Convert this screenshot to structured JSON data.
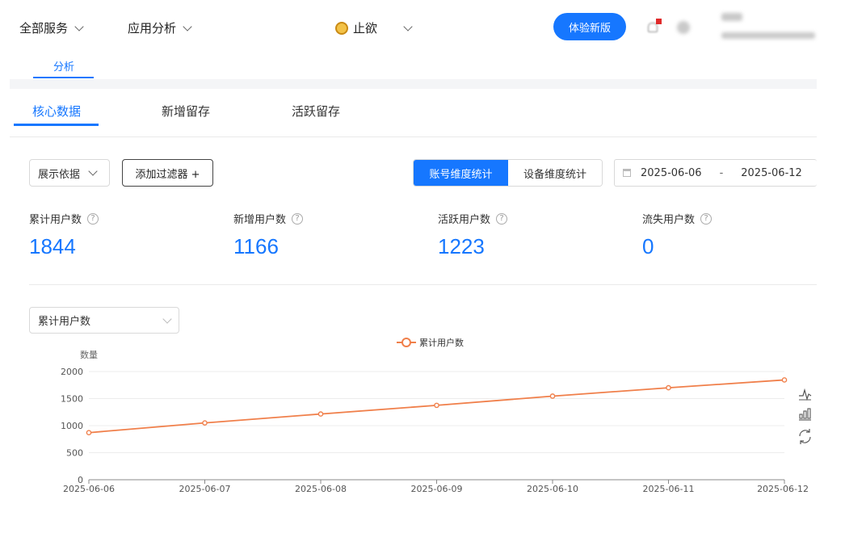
{
  "topnav": {
    "all_services": "全部服务",
    "app_analysis": "应用分析",
    "app_name": "止欲",
    "try_new": "体验新版"
  },
  "subtab": {
    "label": "分析"
  },
  "tabs": [
    {
      "label": "核心数据",
      "active": true
    },
    {
      "label": "新增留存",
      "active": false
    },
    {
      "label": "活跃留存",
      "active": false
    }
  ],
  "filters": {
    "display_basis": "展示依据",
    "add_filter": "添加过滤器 +",
    "account_stats": "账号维度统计",
    "device_stats": "设备维度统计",
    "date_start": "2025-06-06",
    "date_sep": "-",
    "date_end": "2025-06-12"
  },
  "stats": [
    {
      "label": "累计用户数",
      "value": "1844"
    },
    {
      "label": "新增用户数",
      "value": "1166"
    },
    {
      "label": "活跃用户数",
      "value": "1223"
    },
    {
      "label": "流失用户数",
      "value": "0"
    }
  ],
  "metric_select": {
    "value": "累计用户数"
  },
  "colors": {
    "accent": "#1677ff",
    "series": "#f07f4a"
  },
  "chart_data": {
    "type": "line",
    "ylabel": "数量",
    "ylim": [
      0,
      2000
    ],
    "yticks": [
      "0",
      "500",
      "1000",
      "1500",
      "2000"
    ],
    "categories": [
      "2025-06-06",
      "2025-06-07",
      "2025-06-08",
      "2025-06-09",
      "2025-06-10",
      "2025-06-11",
      "2025-06-12"
    ],
    "series": [
      {
        "name": "累计用户数",
        "values": [
          870,
          1050,
          1215,
          1375,
          1545,
          1700,
          1844
        ]
      }
    ],
    "legend": "top-center",
    "grid": true
  }
}
